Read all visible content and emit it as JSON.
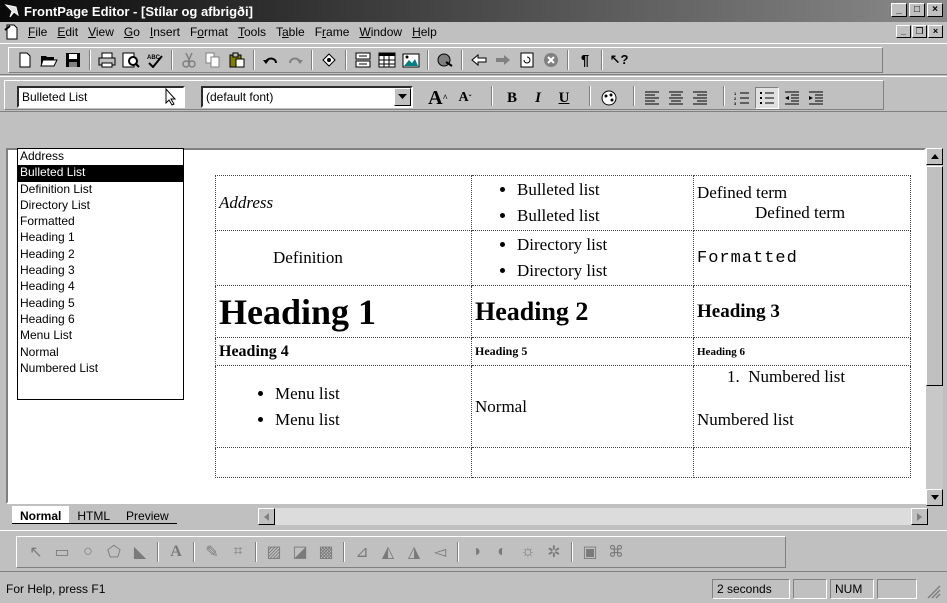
{
  "window": {
    "title": "FrontPage Editor - [Stílar og afbrigði]"
  },
  "menu": {
    "items": [
      {
        "pre": "",
        "key": "F",
        "post": "ile"
      },
      {
        "pre": "",
        "key": "E",
        "post": "dit"
      },
      {
        "pre": "",
        "key": "V",
        "post": "iew"
      },
      {
        "pre": "",
        "key": "G",
        "post": "o"
      },
      {
        "pre": "",
        "key": "I",
        "post": "nsert"
      },
      {
        "pre": "F",
        "key": "o",
        "post": "rmat"
      },
      {
        "pre": "",
        "key": "T",
        "post": "ools"
      },
      {
        "pre": "T",
        "key": "a",
        "post": "ble"
      },
      {
        "pre": "F",
        "key": "r",
        "post": "ame"
      },
      {
        "pre": "",
        "key": "W",
        "post": "indow"
      },
      {
        "pre": "",
        "key": "H",
        "post": "elp"
      }
    ]
  },
  "format": {
    "style_value": "Bulleted List",
    "font_value": "(default font)",
    "grow_label": "A",
    "shrink_label": "A",
    "bold_label": "B",
    "italic_label": "I",
    "underline_label": "U"
  },
  "style_dropdown": {
    "selected": "Bulleted List",
    "options": [
      "Address",
      "Bulleted List",
      "Definition List",
      "Directory List",
      "Formatted",
      "Heading 1",
      "Heading 2",
      "Heading 3",
      "Heading 4",
      "Heading 5",
      "Heading 6",
      "Menu List",
      "Normal",
      "Numbered List"
    ]
  },
  "document": {
    "address": "Address",
    "bulleted": [
      "Bulleted list",
      "Bulleted list"
    ],
    "defined_term": "Defined term",
    "defined_term_def": "Defined term",
    "definition": "Definition",
    "directory": [
      "Directory list",
      "Directory list"
    ],
    "formatted": "Formatted",
    "h1": "Heading 1",
    "h2": "Heading 2",
    "h3": "Heading 3",
    "h4": "Heading 4",
    "h5": "Heading 5",
    "h6": "Heading 6",
    "menu": [
      "Menu list",
      "Menu list"
    ],
    "normal": "Normal",
    "numbered_item": "Numbered list",
    "numbered_marker": "1.",
    "numbered_after": "Numbered list"
  },
  "view_tabs": [
    "Normal",
    "HTML",
    "Preview"
  ],
  "status": {
    "help": "For Help, press F1",
    "time": "2 seconds",
    "num": "NUM"
  }
}
